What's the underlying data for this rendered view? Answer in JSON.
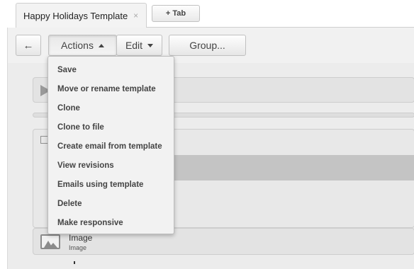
{
  "tabs": {
    "active_label": "Happy Holidays Template",
    "close_glyph": "×",
    "add_label": "+ Tab"
  },
  "toolbar": {
    "back_glyph": "←",
    "actions_label": "Actions",
    "edit_label": "Edit",
    "group_label": "Group..."
  },
  "actions_menu": {
    "items": [
      "Save",
      "Move or rename template",
      "Clone",
      "Clone to file",
      "Create email from template",
      "View revisions",
      "Emails using template",
      "Delete",
      "Make responsive"
    ]
  },
  "content": {
    "image_block": {
      "title": "Image",
      "subtitle": "Image"
    }
  },
  "icons": {
    "back": "arrow-left-icon",
    "actions_caret": "caret-up-icon",
    "edit_caret": "caret-down-icon",
    "email": "envelope-icon",
    "module": "cube-icon",
    "image": "image-icon"
  },
  "colors": {
    "background": "#ececec",
    "menu_background": "#f2f2f2",
    "selected_row": "#c4c4c4"
  }
}
